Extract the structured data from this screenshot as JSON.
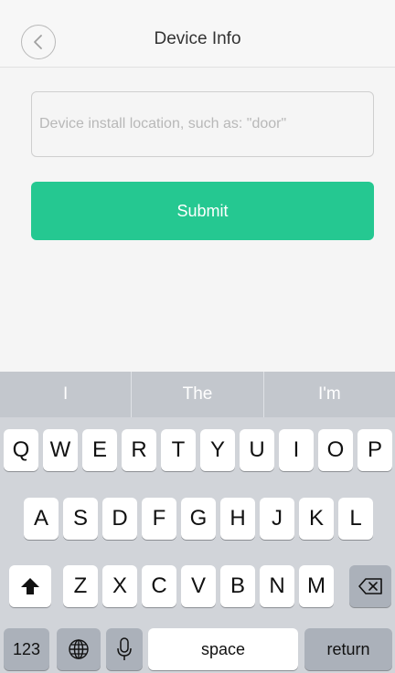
{
  "header": {
    "title": "Device Info",
    "back_icon": "chevron-left-icon"
  },
  "form": {
    "location_placeholder": "Device install location, such as: \"door\"",
    "location_value": "",
    "submit_label": "Submit",
    "submit_color": "#25c891"
  },
  "keyboard": {
    "suggestions": [
      "I",
      "The",
      "I'm"
    ],
    "row1": [
      "Q",
      "W",
      "E",
      "R",
      "T",
      "Y",
      "U",
      "I",
      "O",
      "P"
    ],
    "row2": [
      "A",
      "S",
      "D",
      "F",
      "G",
      "H",
      "J",
      "K",
      "L"
    ],
    "row3": [
      "Z",
      "X",
      "C",
      "V",
      "B",
      "N",
      "M"
    ],
    "shift_icon": "shift-arrow-icon",
    "delete_icon": "backspace-icon",
    "numbers_label": "123",
    "globe_icon": "globe-icon",
    "mic_icon": "microphone-icon",
    "space_label": "space",
    "return_label": "return"
  }
}
